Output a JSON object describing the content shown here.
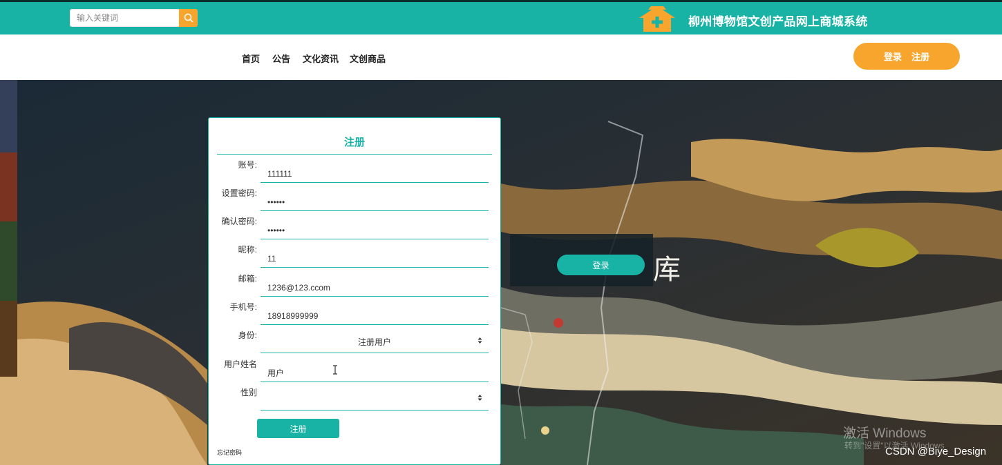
{
  "header": {
    "search_placeholder": "输入关键词",
    "site_title": "柳州博物馆文创产品网上商城系统",
    "colors": {
      "teal": "#18b3a5",
      "orange": "#f7a52c"
    }
  },
  "nav": {
    "items": [
      "首页",
      "公告",
      "文化资讯",
      "文创商品"
    ],
    "login_label": "登录",
    "register_label": "注册"
  },
  "register_form": {
    "title": "注册",
    "fields": [
      {
        "label": "账号:",
        "value": "111111"
      },
      {
        "label": "设置密码:",
        "value": "••••••"
      },
      {
        "label": "确认密码:",
        "value": "••••••"
      },
      {
        "label": "昵称:",
        "value": "11"
      },
      {
        "label": "邮箱:",
        "value": "1236@123.ccom"
      },
      {
        "label": "手机号:",
        "value": "18918999999"
      },
      {
        "label": "身份:",
        "value": "注册用户"
      },
      {
        "label": "用户姓名",
        "value": "用户"
      },
      {
        "label": "性别",
        "value": ""
      }
    ],
    "submit_label": "注册",
    "forgot_label": "忘记密码"
  },
  "overlay": {
    "login_button": "登录",
    "big_char": "库"
  },
  "watermarks": {
    "windows_line1": "激活 Windows",
    "windows_line2": "转到\"设置\"以激活 Windows",
    "csdn": "CSDN @Biye_Design"
  }
}
